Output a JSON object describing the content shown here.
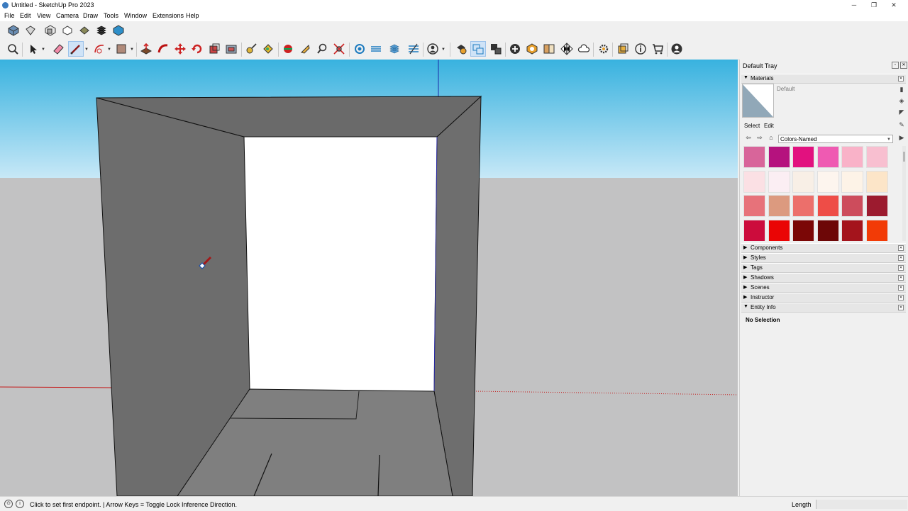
{
  "window": {
    "title": "Untitled - SketchUp Pro 2023",
    "minimize": "─",
    "maximize": "❐",
    "close": "✕"
  },
  "menu": [
    "File",
    "Edit",
    "View",
    "Camera",
    "Draw",
    "Tools",
    "Window",
    "Extensions",
    "Help"
  ],
  "views_toolbar": [
    "iso-view-icon",
    "top-view-icon",
    "front-view-icon",
    "right-view-icon",
    "back-view-icon",
    "left-view-icon",
    "bottom-view-icon"
  ],
  "main_toolbar": [
    "zoom-icon",
    "select-icon",
    "eraser-icon",
    "line-icon",
    "arc-icon",
    "shape-icon",
    "push-pull-icon",
    "follow-me-icon",
    "move-icon",
    "rotate-icon",
    "scale-icon",
    "offset-icon",
    "tape-measure-icon",
    "paint-bucket-icon",
    "orbit-icon",
    "walk-icon",
    "zoom-window-icon",
    "zoom-extents-icon",
    "section-plane-icon",
    "section-cut-icon",
    "section-fill-icon",
    "display-sections-icon",
    "style-icon",
    "warehouse-icon",
    "extension-warehouse-icon",
    "layout-icon",
    "add-location-icon",
    "3d-warehouse-icon",
    "materials-icon",
    "trimble-connect-icon",
    "preferences-icon",
    "outliner-icon",
    "instructor-icon",
    "store-icon",
    "account-icon"
  ],
  "tray": {
    "title": "Default Tray",
    "pin_icon": "pin-icon",
    "close_icon": "close-icon",
    "materials": {
      "label": "Materials",
      "current_material": "Default",
      "tab_select": "Select",
      "tab_edit": "Edit",
      "library": "Colors-Named",
      "swatches": [
        "#d8659a",
        "#b5127e",
        "#e2117f",
        "#ef5ab2",
        "#f9b2c8",
        "#f8bfd0",
        "#fbe0e4",
        "#fbeef3",
        "#f8efe6",
        "#fdf5ee",
        "#fdf3e7",
        "#fce5c8",
        "#e7727a",
        "#dc9a7f",
        "#ec6f6b",
        "#ee4d47",
        "#cd4c5c",
        "#9c1b2f",
        "#cc0c3c",
        "#ea0505",
        "#7b0706",
        "#6d0707",
        "#a4141c",
        "#f23b06"
      ]
    },
    "panels": [
      "Components",
      "Styles",
      "Tags",
      "Shadows",
      "Scenes",
      "Instructor",
      "Entity Info"
    ],
    "entity_info": "No Selection"
  },
  "status": {
    "message": "Click to set first endpoint. | Arrow Keys = Toggle Lock Inference Direction.",
    "measurement_label": "Length",
    "measurement_value": ""
  },
  "colors": {
    "sky_top": "#38b2df",
    "sky_bottom": "#c7e8f7",
    "ground": "#c2c2c3",
    "face": "#6d6d6d",
    "face_dark": "#7f7f7f",
    "selection": "#cfe3f7"
  }
}
